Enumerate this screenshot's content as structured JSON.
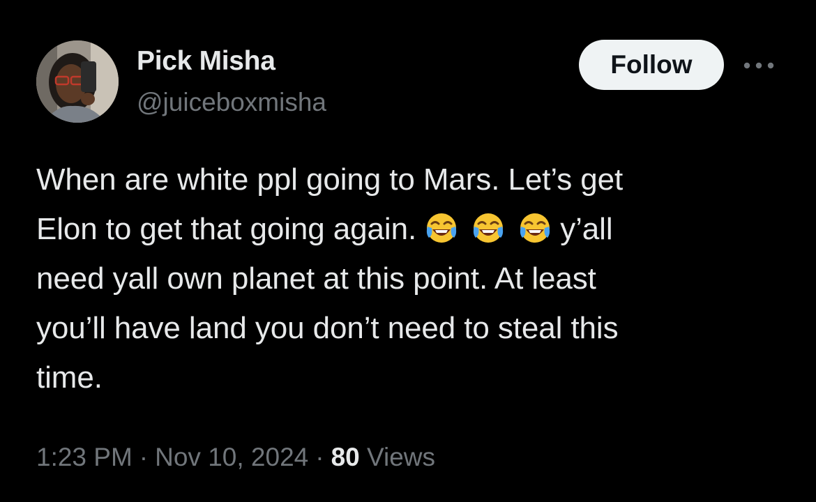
{
  "author": {
    "display_name": "Pick Misha",
    "handle": "@juiceboxmisha"
  },
  "actions": {
    "follow_label": "Follow",
    "more_icon": "more-horizontal-icon"
  },
  "tweet": {
    "line1": "When are white ppl going to Mars. Let’s get",
    "line2_text": "Elon to get that going again.",
    "emoji": [
      "😂",
      "😂",
      "😂"
    ],
    "line2_tail": "y’all",
    "line3": "need yall own planet at this point. At least",
    "line4": "you’ll have land you don’t need to steal this",
    "line5": "time."
  },
  "meta": {
    "time": "1:23 PM",
    "separator": "·",
    "date": "Nov 10, 2024",
    "views_count": "80",
    "views_label": "Views"
  },
  "colors": {
    "background": "#000000",
    "primary_text": "#e7e9ea",
    "secondary_text": "#71767b",
    "follow_button_bg": "#eff3f4",
    "follow_button_text": "#0f1419"
  }
}
